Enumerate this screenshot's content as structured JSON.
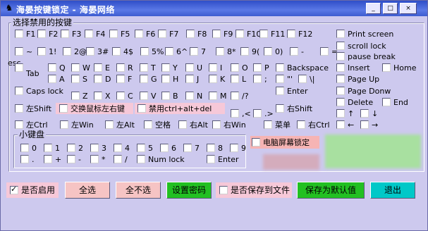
{
  "window": {
    "title": "海晏按键锁定 - 海晏网络",
    "icon": "window-icon"
  },
  "titlebar_buttons": {
    "minimize": "_",
    "maximize": "□",
    "close": "×"
  },
  "colors": {
    "pink": "#f6c8d8",
    "green": "#22c022",
    "cyan": "#00c8c8",
    "salmon": "#f6b4b4",
    "title": "#2f4ec8",
    "blur1": "#d8a0a8",
    "blur2": "#a8e0a0"
  },
  "group_keys": "选择禁用的按键",
  "group_numpad": "小键盘",
  "rows": {
    "f": [
      "F1",
      "F2",
      "F3",
      "F4",
      "F5",
      "F6",
      "F7",
      "F8",
      "F9",
      "F10",
      "F11",
      "F12"
    ],
    "num": [
      "~",
      "1!",
      "2@",
      "3#",
      "4$",
      "5%",
      "6^",
      "7",
      "8*",
      "9(",
      "0)",
      "-",
      "="
    ],
    "q": [
      "Q",
      "W",
      "E",
      "R",
      "T",
      "Y",
      "U",
      "I",
      "O",
      "P",
      "Backspace"
    ],
    "a": [
      "A",
      "S",
      "D",
      "F",
      "G",
      "H",
      "J",
      "K",
      "L",
      ";",
      "\"'",
      "\\|"
    ],
    "z": [
      "Z",
      "X",
      "C",
      "V",
      "B",
      "N",
      "M",
      "/?"
    ],
    "punct": [
      ",<",
      ".>"
    ],
    "arrows_top": [
      "↑",
      "↓"
    ],
    "arrows_bottom": [
      "←",
      "→"
    ]
  },
  "left": {
    "esc": "esc",
    "tab": "Tab",
    "caps": "Caps lock",
    "lshift": "左Shift",
    "lctrl": "左Ctrl",
    "lwin": "左Win",
    "lalt": "左Alt",
    "space": "空格",
    "ralt": "右Alt",
    "rwin": "右Win",
    "menu": "菜单",
    "rctrl": "右Ctrl",
    "rshift": "右Shift",
    "enter": "Enter"
  },
  "nav": {
    "print": "Print screen",
    "scroll": "scroll lock",
    "pause": "pause break",
    "insert": "Insert",
    "home": "Home",
    "pgup": "Page Up",
    "pgdn": "Page Donw",
    "delete": "Delete",
    "end": "End"
  },
  "special": {
    "swap_mouse": "交换鼠标左右键",
    "disable_cad": "禁用ctrl+alt+del",
    "lock_screen": "电脑屏幕锁定"
  },
  "numpad": {
    "digits": [
      "0",
      "1",
      "2",
      "3",
      "4",
      "5",
      "6",
      "7",
      "8",
      "9"
    ],
    "ops": [
      ".",
      "+",
      "-",
      "*",
      "/"
    ],
    "numlock": "Num lock",
    "enter": "Enter"
  },
  "bottom": {
    "enable": "是否启用",
    "select_all": "全选",
    "select_none": "全不选",
    "set_password": "设置密码",
    "save_file": "是否保存到文件",
    "save_default": "保存为默认值",
    "exit": "退出"
  },
  "states": {
    "enable": true
  }
}
